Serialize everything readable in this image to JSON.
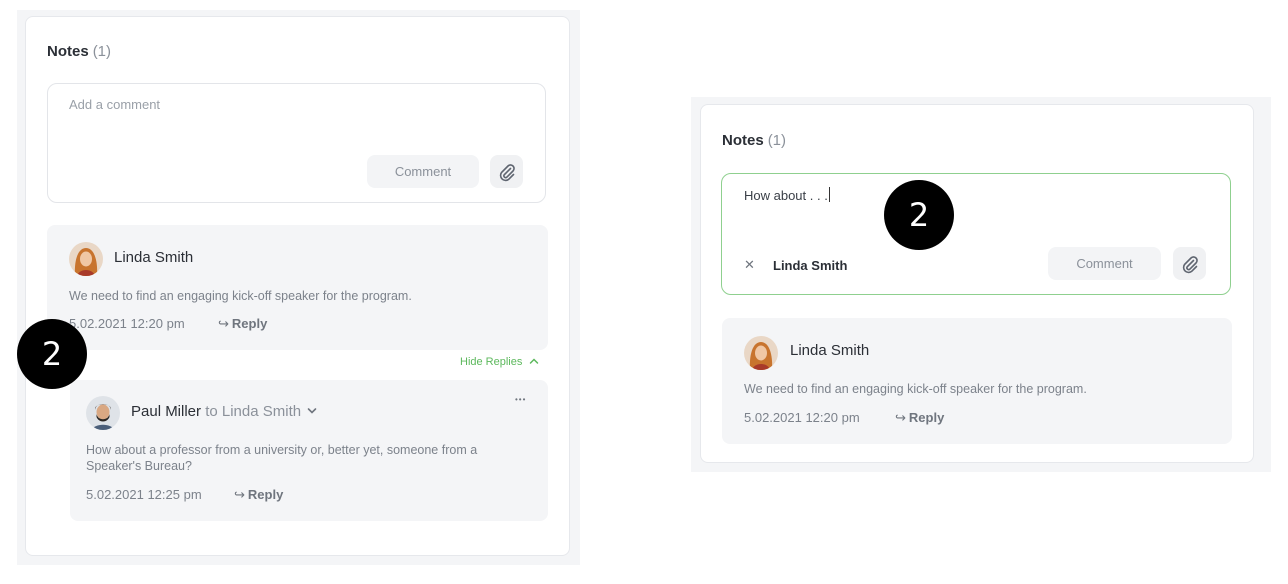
{
  "left": {
    "notes_title": "Notes",
    "notes_count": "(1)",
    "comment_placeholder": "Add a comment",
    "comment_button": "Comment",
    "thread": {
      "author": "Linda Smith",
      "message": "We need to find an engaging kick-off speaker for the program.",
      "timestamp": "5.02.2021 12:20 pm",
      "reply_label": "Reply",
      "hide_replies_label": "Hide Replies",
      "reply_item": {
        "author": "Paul Miller",
        "to_label": "to Linda Smith",
        "message": "How about a professor from a university or, better yet, someone from a Speaker's Bureau?",
        "timestamp": "5.02.2021 12:25 pm",
        "reply_label": "Reply",
        "more_label": "•••"
      }
    },
    "badge": "2"
  },
  "right": {
    "notes_title": "Notes",
    "notes_count": "(1)",
    "comment_text": "How about . . .",
    "mention_name": "Linda Smith",
    "comment_button": "Comment",
    "thread": {
      "author": "Linda Smith",
      "message": "We need to find an engaging kick-off speaker for the program.",
      "timestamp": "5.02.2021 12:20 pm",
      "reply_label": "Reply"
    },
    "badge": "2"
  },
  "colors": {
    "accent_green": "#5cb85c",
    "active_border": "#8fd08f",
    "badge": "#000000"
  }
}
